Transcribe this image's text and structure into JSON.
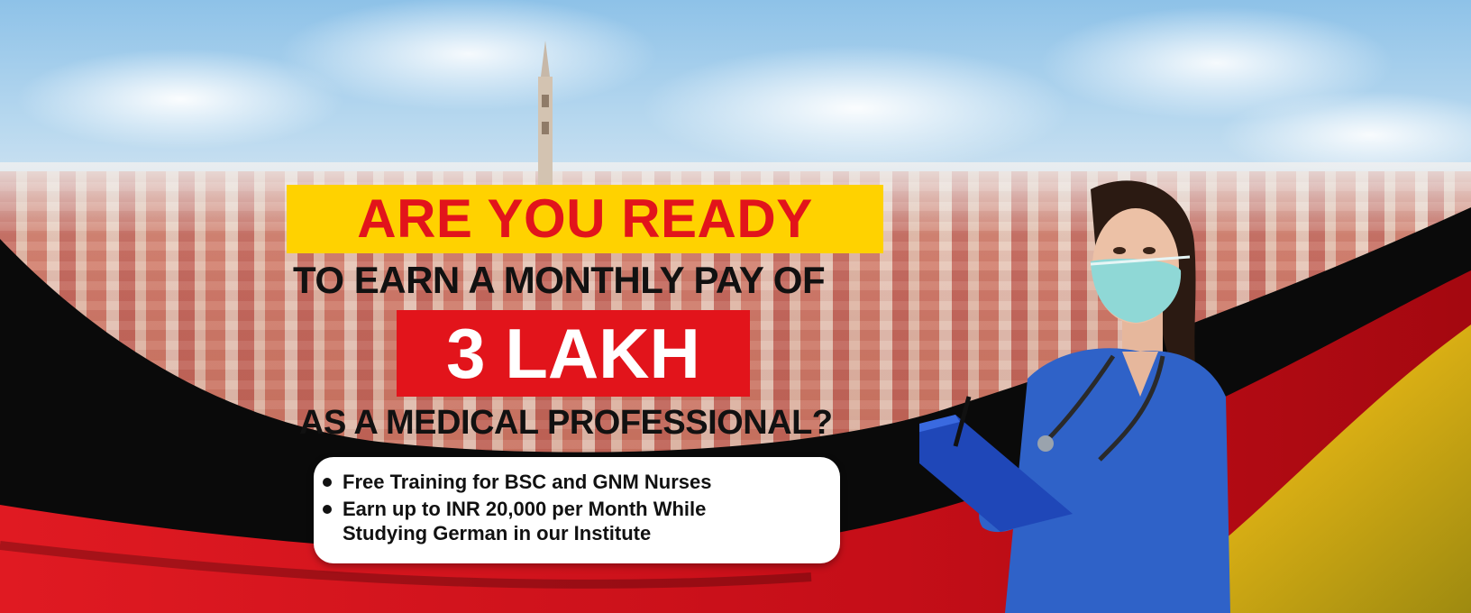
{
  "banner": {
    "headline_line1": "ARE YOU READY",
    "headline_line2": "TO EARN A MONTHLY PAY OF",
    "headline_amount": "3 LAKH",
    "headline_line4": "AS A MEDICAL PROFESSIONAL?",
    "bullets": [
      {
        "text": "Free Training for BSC and GNM Nurses"
      },
      {
        "line1": "Earn up to INR 20,000 per Month While",
        "line2": "Studying German in our Institute"
      }
    ],
    "colors": {
      "highlight_yellow": "#ffd200",
      "highlight_red": "#e2141b",
      "flag_black": "#0a0a0a",
      "flag_red": "#d1101a",
      "flag_gold": "#e0b81a",
      "scrubs_blue": "#2f62c8"
    },
    "images": [
      "munich-city-skyline",
      "german-flag-wave",
      "nurse-with-mask-and-clipboard"
    ]
  }
}
